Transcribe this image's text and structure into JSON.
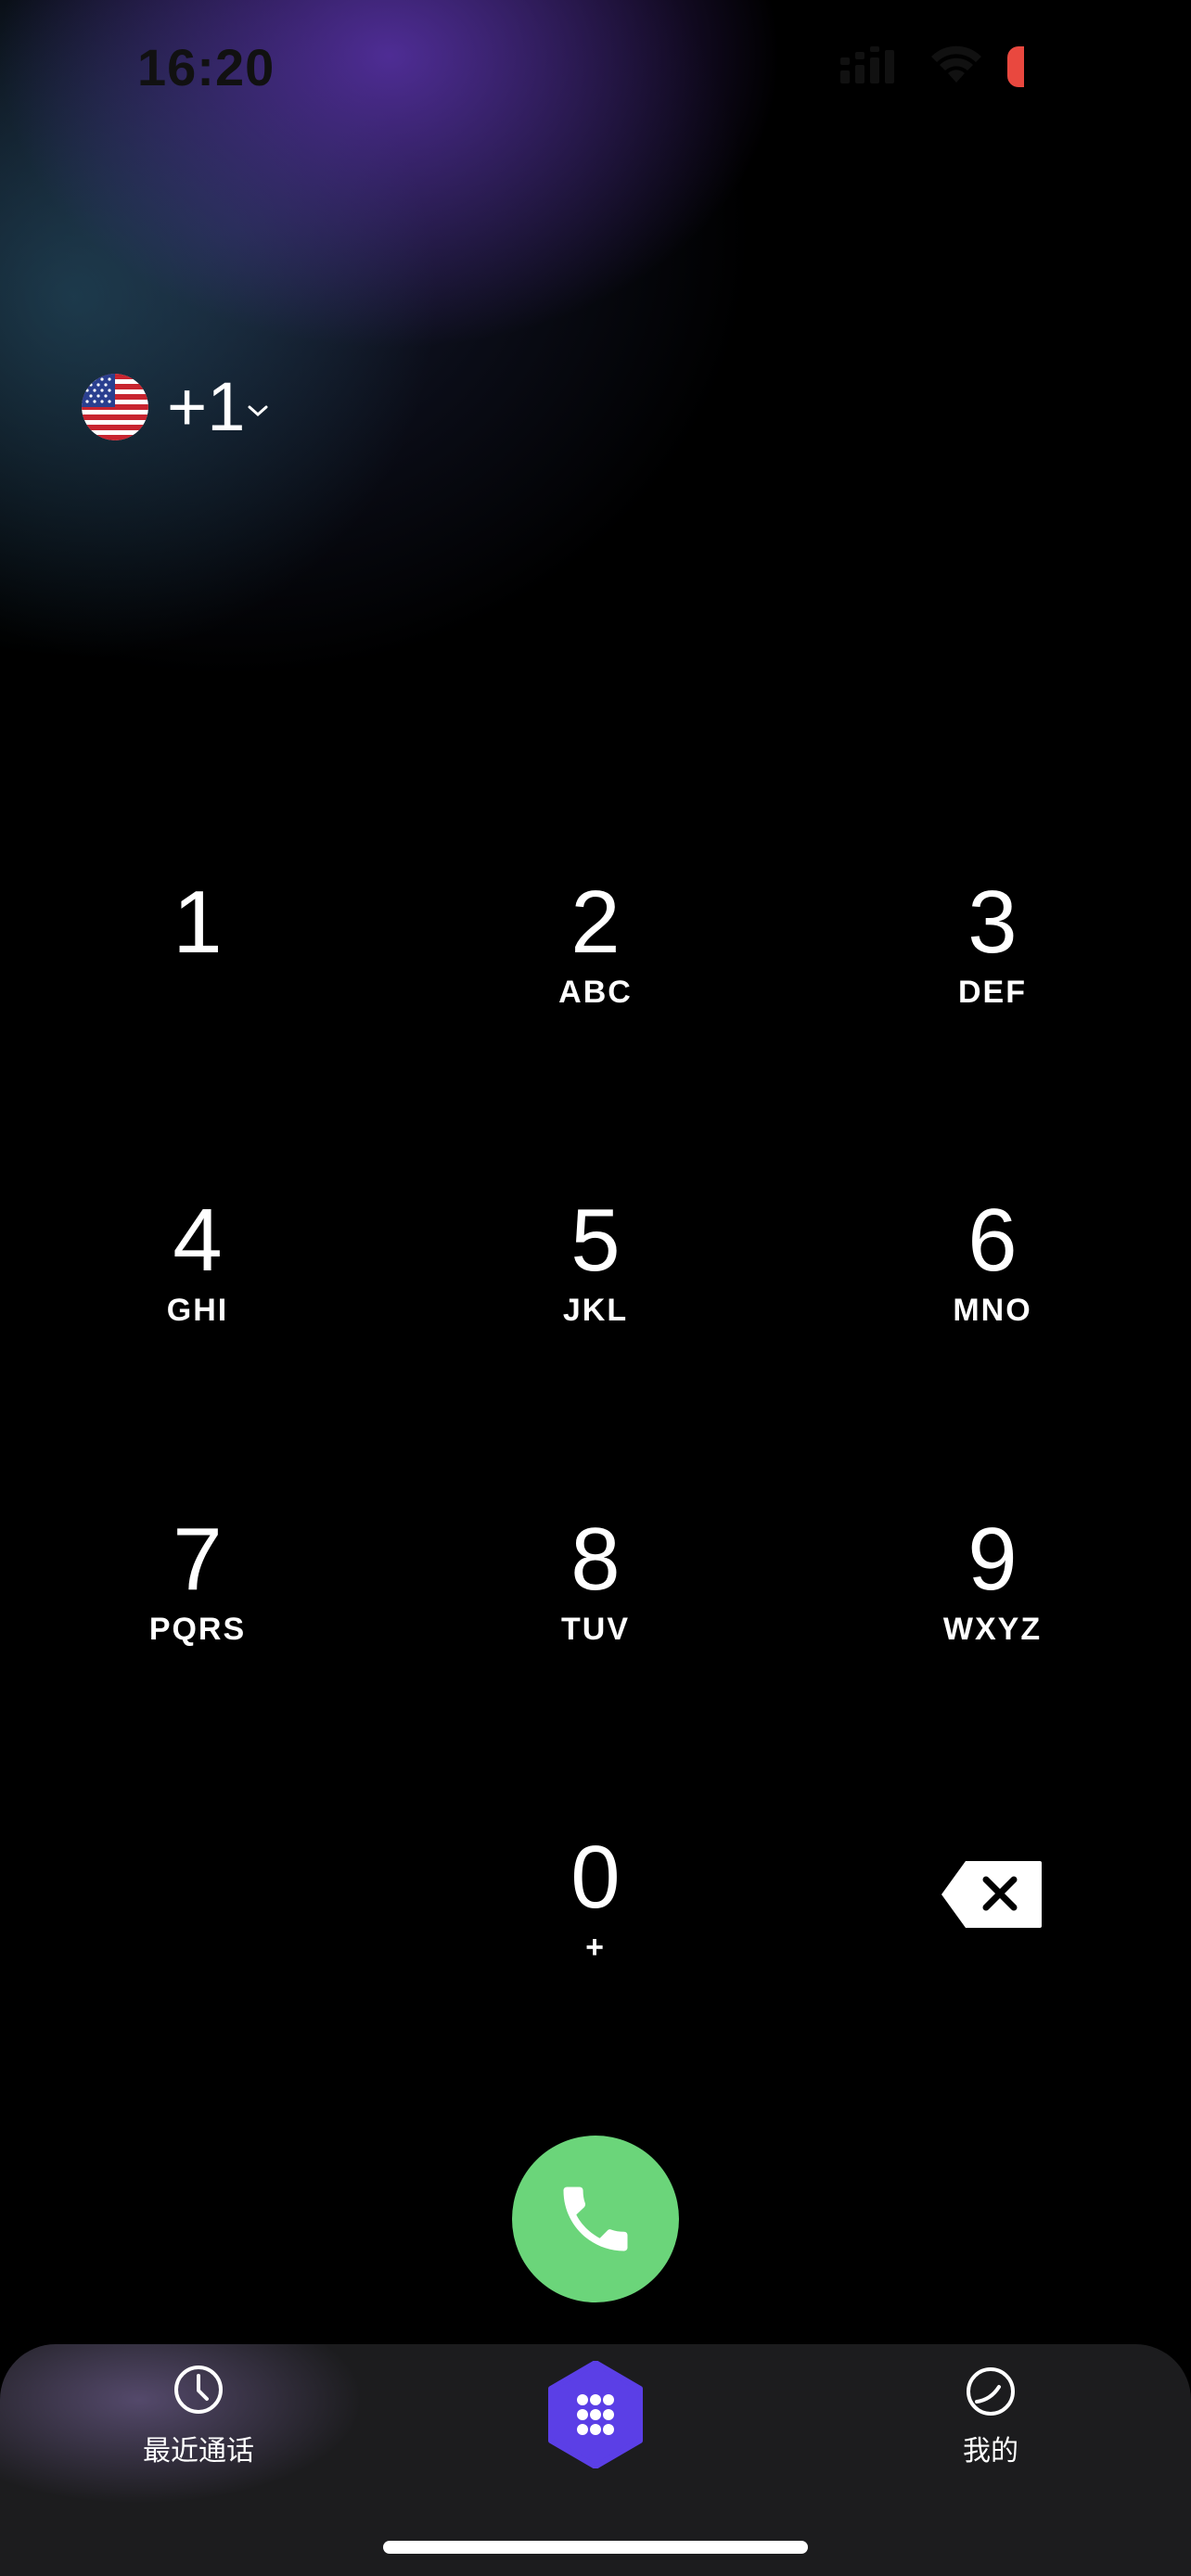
{
  "status_bar": {
    "time": "16:20"
  },
  "dialer": {
    "country_code": "+1",
    "country_flag": "us-flag-icon"
  },
  "keypad": {
    "keys": [
      {
        "digit": "1",
        "letters": ""
      },
      {
        "digit": "2",
        "letters": "ABC"
      },
      {
        "digit": "3",
        "letters": "DEF"
      },
      {
        "digit": "4",
        "letters": "GHI"
      },
      {
        "digit": "5",
        "letters": "JKL"
      },
      {
        "digit": "6",
        "letters": "MNO"
      },
      {
        "digit": "7",
        "letters": "PQRS"
      },
      {
        "digit": "8",
        "letters": "TUV"
      },
      {
        "digit": "9",
        "letters": "WXYZ"
      },
      {
        "digit": "0",
        "letters": "+"
      }
    ]
  },
  "tabbar": {
    "recents_label": "最近通话",
    "me_label": "我的"
  },
  "colors": {
    "call_green": "#6bd57a",
    "keypad_tab_purple": "#5b3fe6",
    "battery_red": "#e9483f",
    "tabbar_bg": "#1c1c1e"
  }
}
